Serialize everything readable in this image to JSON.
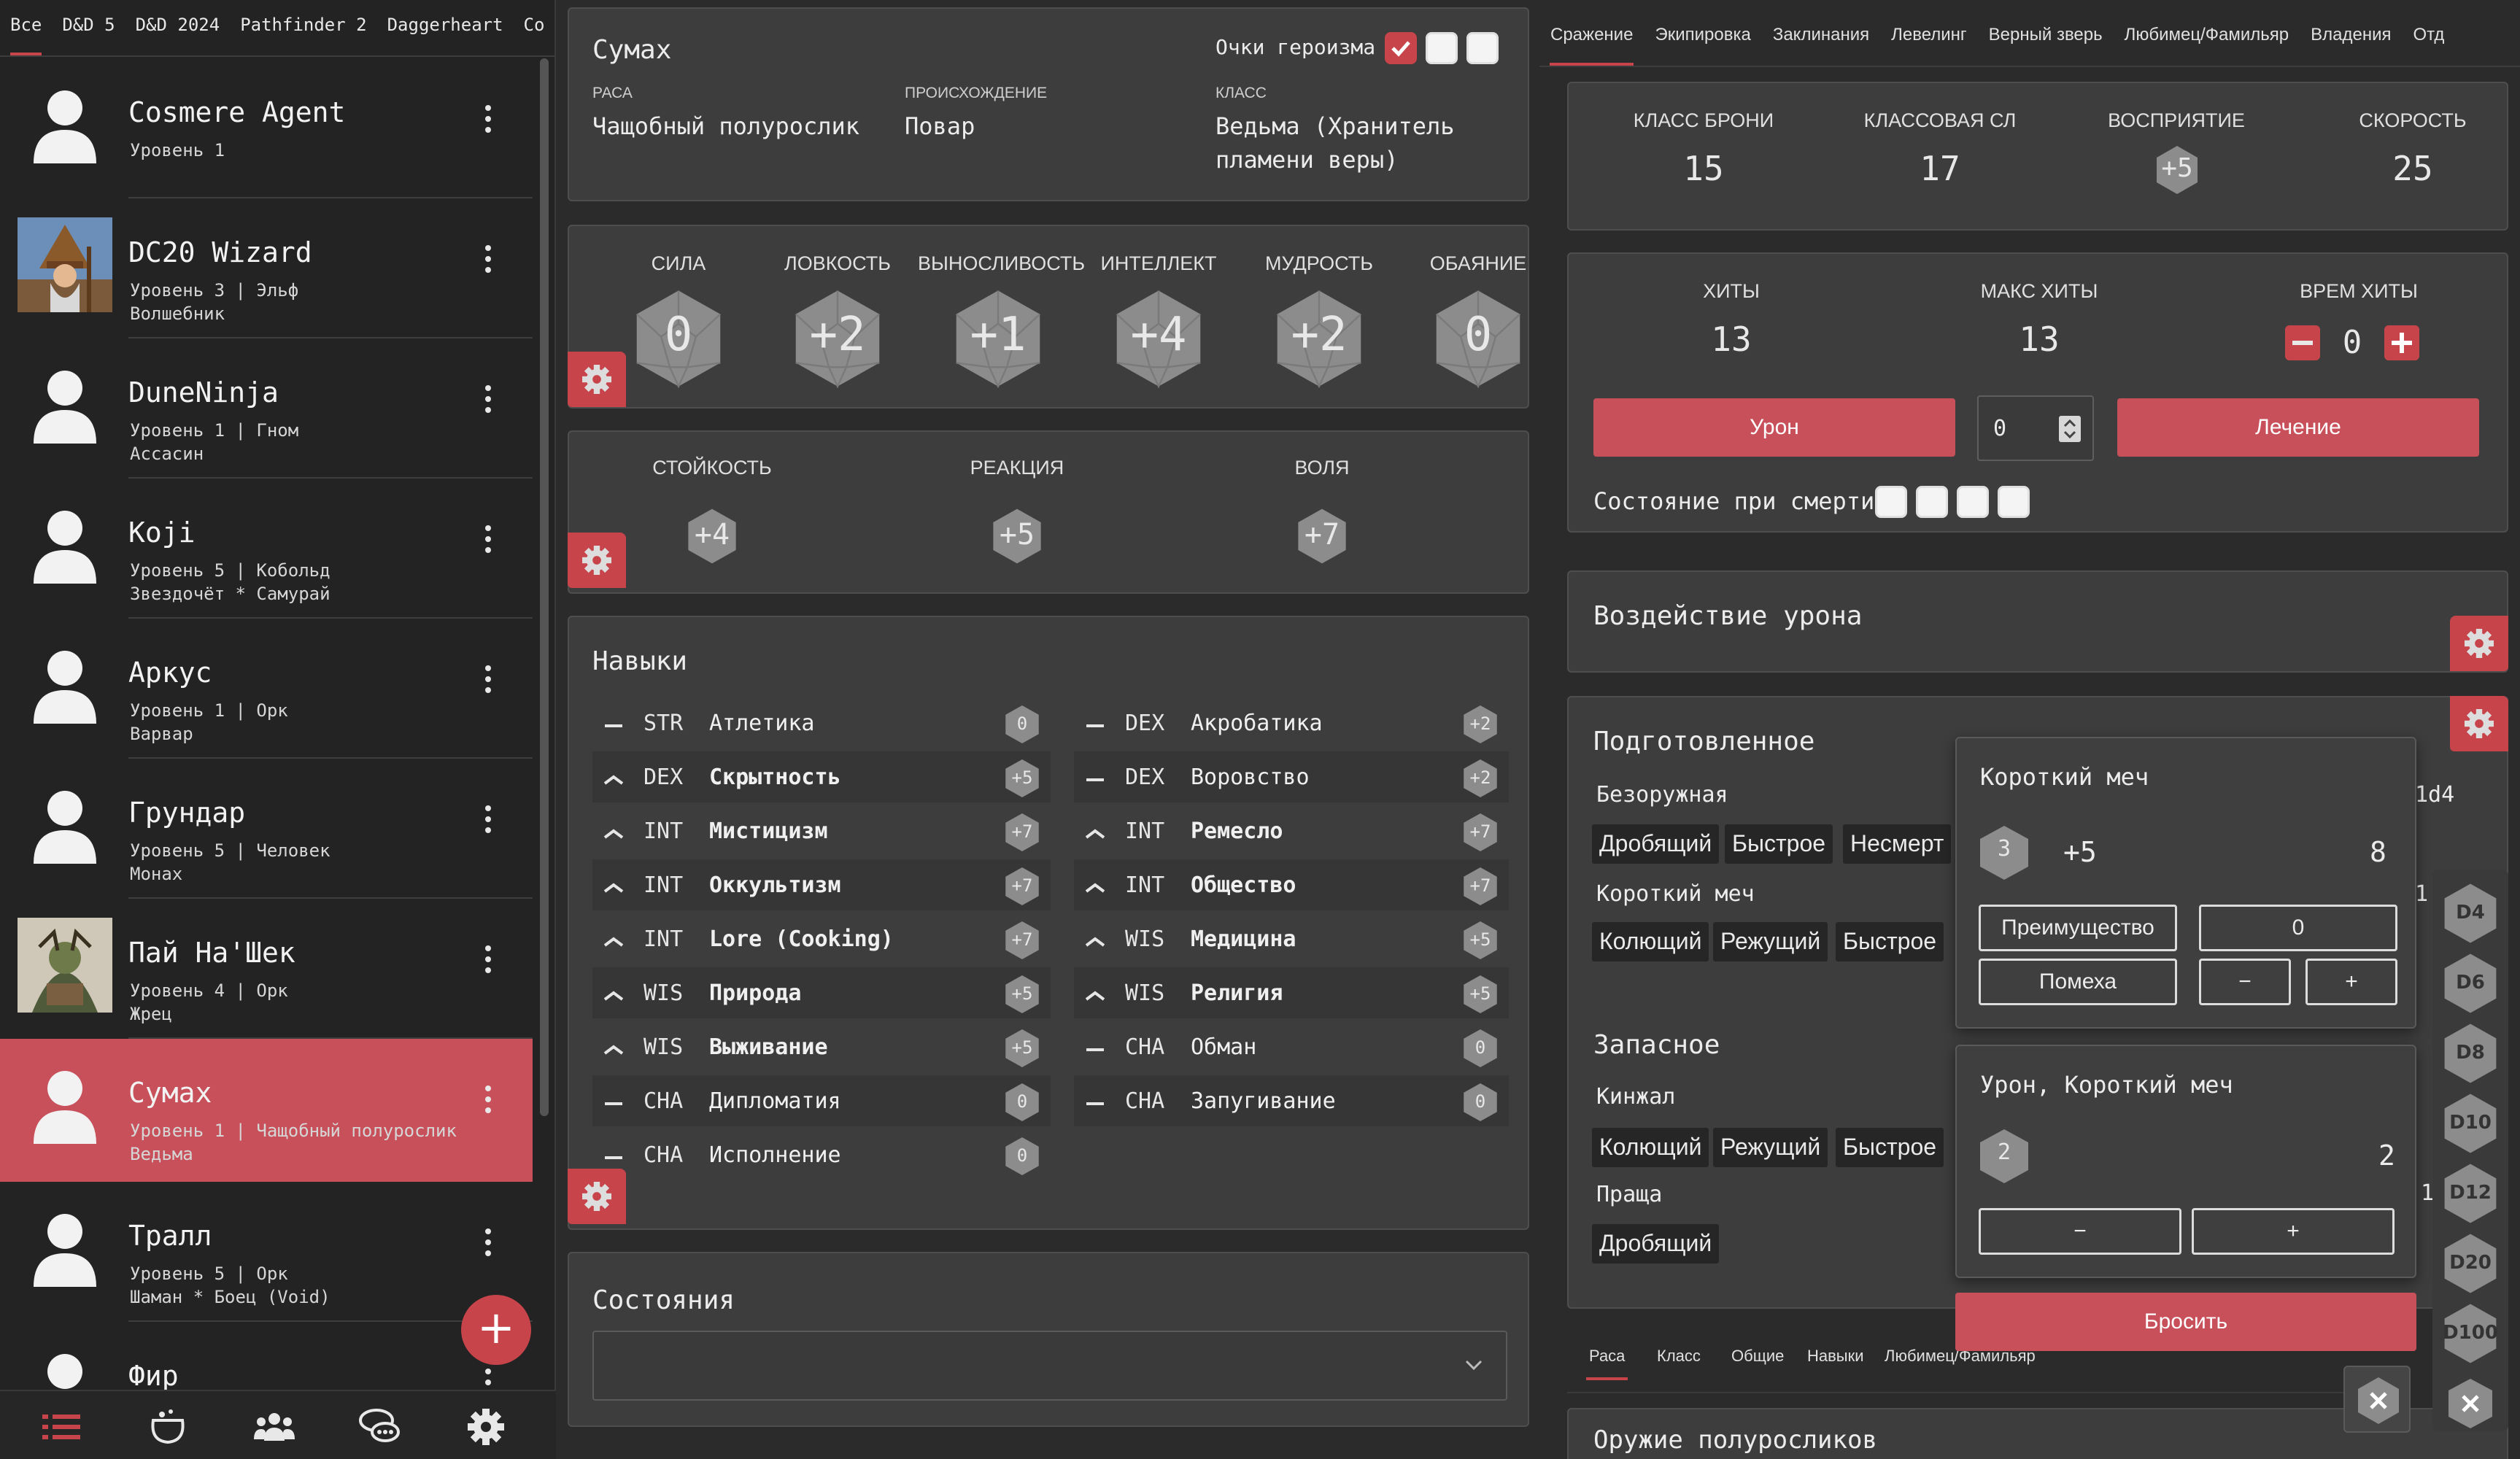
{
  "sidebar": {
    "tabs": [
      "Все",
      "D&D 5",
      "D&D 2024",
      "Pathfinder 2",
      "Daggerheart",
      "Co"
    ],
    "characters": [
      {
        "name": "Cosmere Agent",
        "line1": "Уровень 1",
        "line2": ""
      },
      {
        "name": "DC20 Wizard",
        "line1": "Уровень 3 | Эльф",
        "line2": "Волшебник"
      },
      {
        "name": "DuneNinja",
        "line1": "Уровень 1 | Гном",
        "line2": "Ассасин"
      },
      {
        "name": "Koji",
        "line1": "Уровень 5 | Кобольд",
        "line2": "Звездочёт * Самурай"
      },
      {
        "name": "Аркус",
        "line1": "Уровень 1 | Орк",
        "line2": "Варвар"
      },
      {
        "name": "Грундар",
        "line1": "Уровень 5 | Человек",
        "line2": "Монах"
      },
      {
        "name": "Пай На'Шек",
        "line1": "Уровень 4 | Орк",
        "line2": "Жрец"
      },
      {
        "name": "Сумах",
        "line1": "Уровень 1 | Чащобный полурослик",
        "line2": "Ведьма"
      },
      {
        "name": "Тралл",
        "line1": "Уровень 5 | Орк",
        "line2": "Шаман * Боец (Void)"
      },
      {
        "name": "Фир",
        "line1": "",
        "line2": ""
      }
    ],
    "add_label": "+",
    "nav_icons": [
      "list-icon",
      "cauldron-icon",
      "group-icon",
      "chat-icon",
      "settings-icon"
    ]
  },
  "header": {
    "name": "Сумах",
    "heroism_label": "Очки героизма",
    "race_label": "РАСА",
    "race_value": "Чащобный полурослик",
    "origin_label": "ПРОИСХОЖДЕНИЕ",
    "origin_value": "Повар",
    "class_label": "КЛАСС",
    "class_value_1": "Ведьма (Хранитель",
    "class_value_2": "пламени веры)"
  },
  "abilities": [
    {
      "label": "СИЛА",
      "value": "0"
    },
    {
      "label": "ЛОВКОСТЬ",
      "value": "+2"
    },
    {
      "label": "ВЫНОСЛИВОСТЬ",
      "value": "+1"
    },
    {
      "label": "ИНТЕЛЛЕКТ",
      "value": "+4"
    },
    {
      "label": "МУДРОСТЬ",
      "value": "+2"
    },
    {
      "label": "ОБАЯНИЕ",
      "value": "0"
    }
  ],
  "saves": [
    {
      "label": "СТОЙКОСТЬ",
      "value": "+4"
    },
    {
      "label": "РЕАКЦИЯ",
      "value": "+5"
    },
    {
      "label": "ВОЛЯ",
      "value": "+7"
    }
  ],
  "skills": {
    "title": "Навыки",
    "left": [
      {
        "attr": "STR",
        "name": "Атлетика",
        "value": "0"
      },
      {
        "attr": "DEX",
        "name": "Скрытность",
        "value": "+5"
      },
      {
        "attr": "INT",
        "name": "Мистицизм",
        "value": "+7"
      },
      {
        "attr": "INT",
        "name": "Оккультизм",
        "value": "+7"
      },
      {
        "attr": "INT",
        "name": "Lore (Cooking)",
        "value": "+7"
      },
      {
        "attr": "WIS",
        "name": "Природа",
        "value": "+5"
      },
      {
        "attr": "WIS",
        "name": "Выживание",
        "value": "+5"
      },
      {
        "attr": "CHA",
        "name": "Дипломатия",
        "value": "0"
      },
      {
        "attr": "CHA",
        "name": "Исполнение",
        "value": "0"
      }
    ],
    "right": [
      {
        "attr": "DEX",
        "name": "Акробатика",
        "value": "+2"
      },
      {
        "attr": "DEX",
        "name": "Воровство",
        "value": "+2"
      },
      {
        "attr": "INT",
        "name": "Ремесло",
        "value": "+7"
      },
      {
        "attr": "INT",
        "name": "Общество",
        "value": "+7"
      },
      {
        "attr": "WIS",
        "name": "Медицина",
        "value": "+5"
      },
      {
        "attr": "WIS",
        "name": "Религия",
        "value": "+5"
      },
      {
        "attr": "CHA",
        "name": "Обман",
        "value": "0"
      },
      {
        "attr": "CHA",
        "name": "Запугивание",
        "value": "0"
      }
    ]
  },
  "conditions": {
    "title": "Состояния"
  },
  "right_tabs": [
    "Сражение",
    "Экипировка",
    "Заклинания",
    "Левелинг",
    "Верный зверь",
    "Любимец/Фамильяр",
    "Владения",
    "Отд"
  ],
  "combat": {
    "ac_label": "КЛАСС БРОНИ",
    "ac_value": "15",
    "dc_label": "КЛАССОВАЯ СЛ",
    "dc_value": "17",
    "perception_label": "ВОСПРИЯТИЕ",
    "perception_value": "+5",
    "speed_label": "СКОРОСТЬ",
    "speed_value": "25"
  },
  "hp": {
    "hp_label": "ХИТЫ",
    "hp_value": "13",
    "max_label": "МАКС ХИТЫ",
    "max_value": "13",
    "temp_label": "ВРЕМ ХИТЫ",
    "temp_value": "0",
    "damage_label": "Урон",
    "heal_label": "Лечение",
    "amount": "0",
    "death_label": "Состояние при смерти"
  },
  "damage_effects": {
    "title": "Воздействие урона"
  },
  "prepared": {
    "title": "Подготовленное",
    "unarmed_label": "Безоружная",
    "unarmed_tags": [
      "Дробящий",
      "Быстрое",
      "Несмерт"
    ],
    "shortsword_label": "Короткий меч",
    "shortsword_tags": [
      "Колющий",
      "Режущий",
      "Быстрое"
    ],
    "reserve_title": "Запасное",
    "dagger_label": "Кинжал",
    "dagger_tags": [
      "Колющий",
      "Режущий",
      "Быстрое"
    ],
    "sling_label": "Праща",
    "sling_tags": [
      "Дробящий"
    ],
    "peek_1": "1d4",
    "peek_2": "1",
    "peek_3": "1"
  },
  "attack_popup": {
    "title": "Короткий меч",
    "dice_count": "3",
    "bonus": "+5",
    "total": "8",
    "advantage_label": "Преимущество",
    "disadvantage_label": "Помеха",
    "modifier": "0",
    "minus": "−",
    "plus": "+"
  },
  "damage_popup": {
    "title": "Урон, Короткий меч",
    "dice_count": "2",
    "total": "2",
    "minus": "−",
    "plus": "+"
  },
  "roll_button": "Бросить",
  "dice": [
    "D4",
    "D6",
    "D8",
    "D10",
    "D12",
    "D20",
    "D100"
  ],
  "close_icon": "×",
  "bottom_tabs": [
    "Раса",
    "Класс",
    "Общие",
    "Навыки",
    "Любимец/Фамильяр"
  ],
  "bottom_section": "Оружие полуросликов",
  "colors": {
    "accent": "#c8444b",
    "panel": "#3d3d3d",
    "background": "#2b2b2b",
    "hex": "#8c8c8c"
  }
}
